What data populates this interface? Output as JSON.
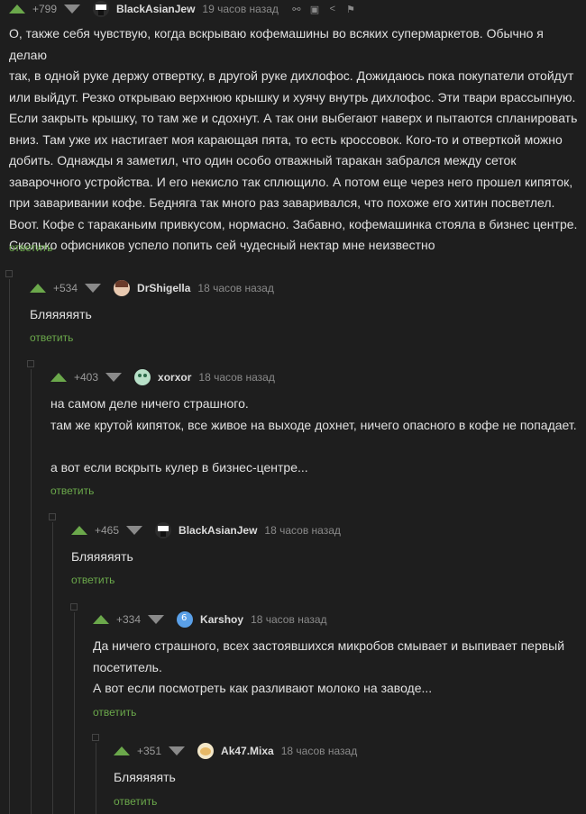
{
  "comments": [
    {
      "rating": "+799",
      "author": "BlackAsianJew",
      "time": "19 часов назад",
      "lines": [
        "О, также себя чувствую, когда вскрываю кофемашины во всяких супермаркетов. Обычно я делаю",
        "так, в одной руке держу отвертку, в другой руке дихлофос. Дожидаюсь пока покупатели отойдут",
        "или выйдут. Резко открываю верхнюю крышку и хуячу внутрь дихлофос. Эти твари врассыпную.",
        "Если закрыть крышку, то там же и сдохнут. А так они выбегают наверх и пытаются спланировать",
        "вниз. Там уже их настигает моя карающая пята, то есть кроссовок. Кого-то и отверткой можно",
        "добить. Однажды я заметил, что один особо отважный таракан забрался между сеток",
        "заварочного устройства. И его некисло так сплющило. А потом еще через него прошел кипяток,",
        "при заваривании кофе. Бедняга так много раз заваривался, что похоже его хитин посветлел.",
        "Воот. Кофе с тараканьим привкусом, нормасно. Забавно, кофемашинка стояла в бизнес центре.",
        "Сколько офисников успело попить сей чудесный нектар мне неизвестно"
      ],
      "reply": "ответить"
    },
    {
      "rating": "+534",
      "author": "DrShigella",
      "time": "18 часов назад",
      "lines": [
        "Бляяяяять"
      ],
      "reply": "ответить"
    },
    {
      "rating": "+403",
      "author": "xorxor",
      "time": "18 часов назад",
      "lines": [
        "на самом деле ничего страшного.",
        "там же крутой кипяток, все живое на выходе дохнет, ничего опасного в кофе не попадает.",
        "",
        "а вот если вскрыть кулер в бизнес-центре..."
      ],
      "reply": "ответить"
    },
    {
      "rating": "+465",
      "author": "BlackAsianJew",
      "time": "18 часов назад",
      "lines": [
        "Бляяяяять"
      ],
      "reply": "ответить"
    },
    {
      "rating": "+334",
      "author": "Karshoy",
      "time": "18 часов назад",
      "lines": [
        "Да ничего страшного, всех застоявшихся микробов смывает и выпивает первый",
        "посетитель.",
        "А вот если посмотреть как разливают молоко на заводе..."
      ],
      "reply": "ответить"
    },
    {
      "rating": "+351",
      "author": "Ak47.Mixa",
      "time": "18 часов назад",
      "lines": [
        "Бляяяяять"
      ],
      "reply": "ответить"
    }
  ],
  "tools": [
    "link-icon",
    "save-icon",
    "share-icon",
    "flag-icon"
  ],
  "colors": {
    "background": "#1e1e1e",
    "upvote": "#6ba84b",
    "reply": "#6ba84b",
    "muted": "#8a8a8a"
  }
}
